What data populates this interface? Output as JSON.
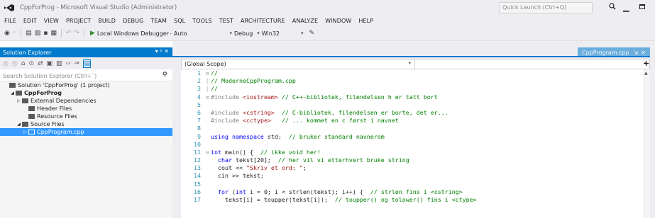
{
  "window": {
    "title": "CppForProg - Microsoft Visual Studio (Administrator)",
    "quick_launch_placeholder": "Quick Launch (Ctrl+Q)",
    "minimize": "▁"
  },
  "menu": [
    "FILE",
    "EDIT",
    "VIEW",
    "PROJECT",
    "BUILD",
    "DEBUG",
    "TEAM",
    "SQL",
    "TOOLS",
    "TEST",
    "ARCHITECTURE",
    "ANALYZE",
    "WINDOW",
    "HELP"
  ],
  "toolbar": {
    "start_label": "Local Windows Debugger",
    "start_mode": "Auto",
    "config": "Debug",
    "platform": "Win32"
  },
  "solution_explorer": {
    "title": "Solution Explorer",
    "header_buttons": "▾ ᵖ ✕",
    "search_placeholder": "Search Solution Explorer (Ctrl+`)",
    "tree": [
      {
        "label": "Solution 'CppForProg' (1 project)",
        "indent": 0,
        "arrow": "",
        "bold": false,
        "selected": false,
        "icon": "solution-icon"
      },
      {
        "label": "CppForProg",
        "indent": 1,
        "arrow": "◢",
        "bold": true,
        "selected": false,
        "icon": "project-icon"
      },
      {
        "label": "External Dependencies",
        "indent": 2,
        "arrow": "▷",
        "bold": false,
        "selected": false,
        "icon": "folder-icon"
      },
      {
        "label": "Header Files",
        "indent": 3,
        "arrow": "",
        "bold": false,
        "selected": false,
        "icon": "folder-icon"
      },
      {
        "label": "Resource Files",
        "indent": 3,
        "arrow": "",
        "bold": false,
        "selected": false,
        "icon": "folder-icon"
      },
      {
        "label": "Source Files",
        "indent": 2,
        "arrow": "◢",
        "bold": false,
        "selected": false,
        "icon": "folder-icon"
      },
      {
        "label": "CppProgram.cpp",
        "indent": 3,
        "arrow": "▷",
        "bold": false,
        "selected": true,
        "icon": "cpp-file-icon"
      }
    ]
  },
  "editor": {
    "tab": "CppProgram.cpp",
    "scope": "(Global Scope)",
    "lines": [
      {
        "n": "1",
        "fold": "⊟",
        "html": "<span class='cm'>//</span>"
      },
      {
        "n": "2",
        "fold": "│",
        "html": "<span class='cm'>// ModerneCppProgram.cpp</span>"
      },
      {
        "n": "3",
        "fold": "│",
        "html": "<span class='cm'>//</span>"
      },
      {
        "n": "4",
        "fold": "⊟",
        "html": "<span class='pp'>#include</span> <span class='str'>&lt;iostream&gt;</span> <span class='cm'>// C++-bibliotek, filendelsen h er tatt bort</span>"
      },
      {
        "n": "5",
        "fold": "",
        "html": ""
      },
      {
        "n": "6",
        "fold": "",
        "html": "<span class='pp'>#include</span> <span class='str'>&lt;cstring&gt;</span>  <span class='cm'>// C-bibliotek, filendelsen er borte, det er...</span>"
      },
      {
        "n": "7",
        "fold": "",
        "html": "<span class='pp'>#include</span> <span class='str'>&lt;cctype&gt;</span>   <span class='cm'>// ... kommet en c først i navnet</span>"
      },
      {
        "n": "8",
        "fold": "",
        "html": ""
      },
      {
        "n": "9",
        "fold": "",
        "html": "<span class='kw'>using namespace</span> std;  <span class='cm'>// bruker standard navnerom</span>"
      },
      {
        "n": "10",
        "fold": "",
        "html": ""
      },
      {
        "n": "11",
        "fold": "⊟",
        "html": "<span class='kw'>int</span> main() {  <span class='cm'>// ikke void her!</span>"
      },
      {
        "n": "12",
        "fold": "",
        "html": "  <span class='kw'>char</span> tekst[20];  <span class='cm'>// her vil vi etterhvert bruke string</span>"
      },
      {
        "n": "13",
        "fold": "",
        "html": "  cout &lt;&lt; <span class='str'>\"Skriv et ord: \"</span>;"
      },
      {
        "n": "14",
        "fold": "",
        "html": "  cin &gt;&gt; tekst;"
      },
      {
        "n": "15",
        "fold": "",
        "html": ""
      },
      {
        "n": "16",
        "fold": "",
        "html": "  <span class='kw'>for</span> (<span class='kw'>int</span> i = 0; i &lt; strlen(tekst); i++) {  <span class='cm'>// strlen fins i &lt;cstring&gt;</span>"
      },
      {
        "n": "17",
        "fold": "",
        "html": "    tekst[i] = toupper(tekst[i]);  <span class='cm'>// toupper() og tolower() fins i &lt;ctype&gt;</span>"
      }
    ]
  },
  "colors": {
    "accent": "#007acc",
    "selected": "#3399ff",
    "keyword": "#0000ff",
    "comment": "#008000",
    "string": "#a31515",
    "line_number": "#2b91af"
  }
}
